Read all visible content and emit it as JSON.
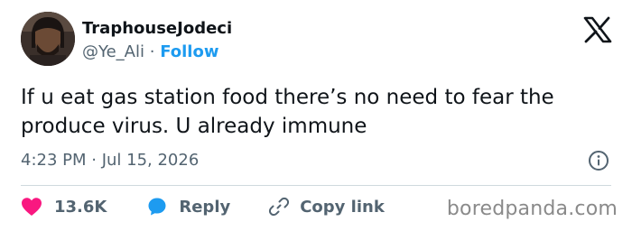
{
  "tweet": {
    "display_name": "TraphouseJodeci",
    "handle": "@Ye_Ali",
    "separator": "·",
    "follow_label": "Follow",
    "text": "If u eat gas station food there’s no need to fear the produce virus. U already immune",
    "timestamp": "4:23 PM · Jul 15, 2026"
  },
  "actions": {
    "like_count": "13.6K",
    "reply_label": "Reply",
    "copy_link_label": "Copy link"
  },
  "icons": {
    "logo": "x-logo-icon",
    "info": "info-icon",
    "like": "heart-icon",
    "reply": "speech-bubble-icon",
    "copy_link": "link-icon"
  },
  "colors": {
    "accent": "#1d9bf0",
    "like": "#f91880",
    "text": "#0f1419",
    "muted": "#536471"
  },
  "watermark": "boredpanda.com"
}
